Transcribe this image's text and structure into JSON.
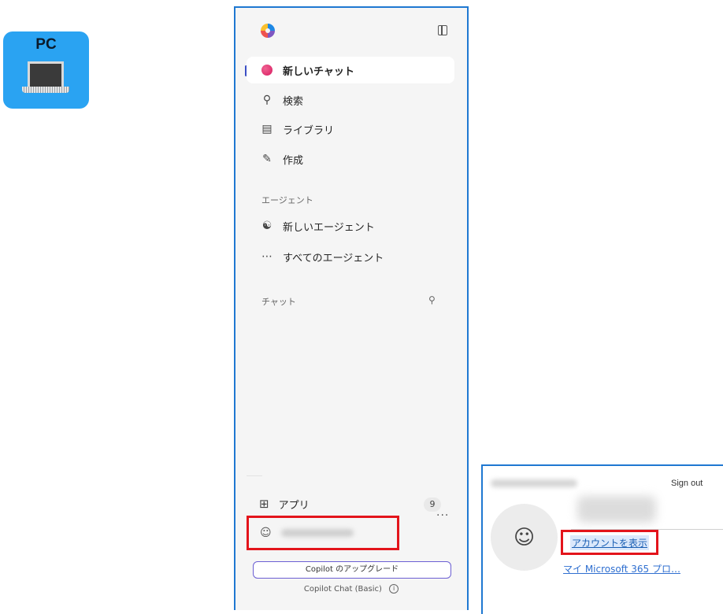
{
  "badge": {
    "label": "PC"
  },
  "sidebar": {
    "nav": [
      {
        "label": "新しいチャット",
        "icon": "copilot-dot-icon"
      },
      {
        "label": "検索",
        "icon": "search-icon"
      },
      {
        "label": "ライブラリ",
        "icon": "library-icon"
      },
      {
        "label": "作成",
        "icon": "create-icon"
      }
    ],
    "agents_section": "エージェント",
    "agents": [
      {
        "label": "新しいエージェント",
        "icon": "new-agent-icon"
      },
      {
        "label": "すべてのエージェント",
        "icon": "more-icon"
      }
    ],
    "chats_section": "チャット",
    "apps": {
      "label": "アプリ",
      "count": "9"
    },
    "account": {
      "more": "···"
    },
    "upgrade_label": "Copilot のアップグレード",
    "plan_label": "Copilot Chat (Basic)"
  },
  "popup": {
    "sign_out": "Sign out",
    "view_account": "アカウントを表示",
    "m365_profile": "マイ Microsoft 365 プロ…"
  },
  "colors": {
    "highlight_border": "#e3141b",
    "frame_border": "#1f78d1",
    "badge_bg": "#2aa3f2",
    "upgrade_border": "#6b5fd3"
  }
}
